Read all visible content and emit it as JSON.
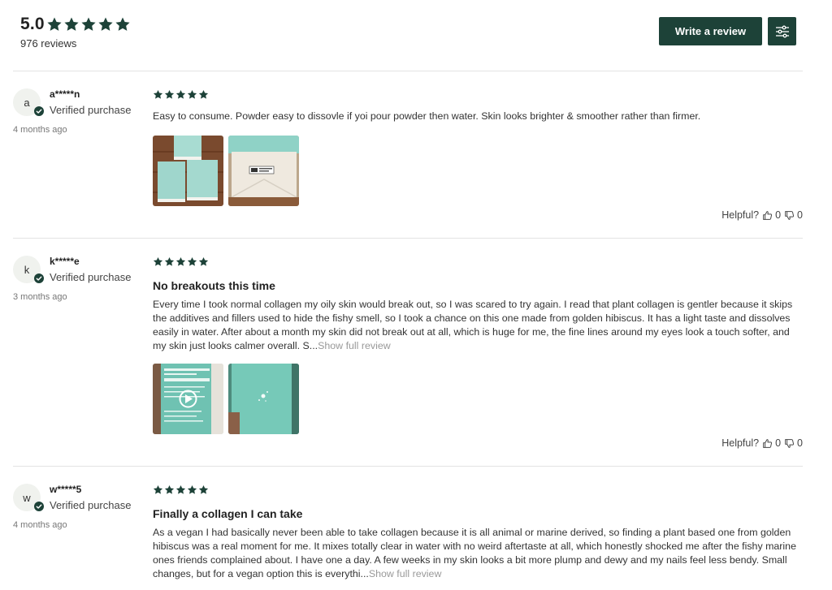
{
  "summary": {
    "average": "5.0",
    "star_count": 5,
    "total_reviews": "976 reviews",
    "write_review_label": "Write a review",
    "filter_icon": "sliders-icon"
  },
  "colors": {
    "brand": "#1d4238",
    "muted": "#999999",
    "divider": "#e3e3e3"
  },
  "reviews": [
    {
      "avatar_letter": "a",
      "author": "a*****n",
      "verified_label": "Verified purchase",
      "date": "4 months ago",
      "rating": 5,
      "title": "",
      "body": "Easy to consume. Powder easy to dissovle if yoi pour powder then water. Skin looks brighter & smoother rather than firmer.",
      "show_full": "",
      "media": [
        "photo-green-boxes",
        "photo-box-label"
      ],
      "helpful_label": "Helpful?",
      "helpful_yes": "0",
      "helpful_no": "0"
    },
    {
      "avatar_letter": "k",
      "author": "k*****e",
      "verified_label": "Verified purchase",
      "date": "3 months ago",
      "rating": 5,
      "title": "No breakouts this time",
      "body": "Every time I took normal collagen my oily skin would break out, so I was scared to try again. I read that plant collagen is gentler because it skips the additives and fillers used to hide the fishy smell, so I took a chance on this one made from golden hibiscus. It has a light taste and dissolves easily in water. After about a month my skin did not break out at all, which is huge for me, the fine lines around my eyes look a touch softer, and my skin just looks calmer overall. S...",
      "show_full": "Show full review",
      "media": [
        "video-nutrition-label",
        "photo-green-pouch"
      ],
      "helpful_label": "Helpful?",
      "helpful_yes": "0",
      "helpful_no": "0"
    },
    {
      "avatar_letter": "w",
      "author": "w*****5",
      "verified_label": "Verified purchase",
      "date": "4 months ago",
      "rating": 5,
      "title": "Finally a collagen I can take",
      "body": "As a vegan I had basically never been able to take collagen because it is all animal or marine derived, so finding a plant based one from golden hibiscus was a real moment for me. It mixes totally clear in water with no weird aftertaste at all, which honestly shocked me after the fishy marine ones friends complained about. I have one a day. A few weeks in my skin looks a bit more plump and dewy and my nails feel less bendy. Small changes, but for a vegan option this is everythi...",
      "show_full": "Show full review",
      "media": [],
      "helpful_label": "",
      "helpful_yes": "",
      "helpful_no": ""
    }
  ]
}
